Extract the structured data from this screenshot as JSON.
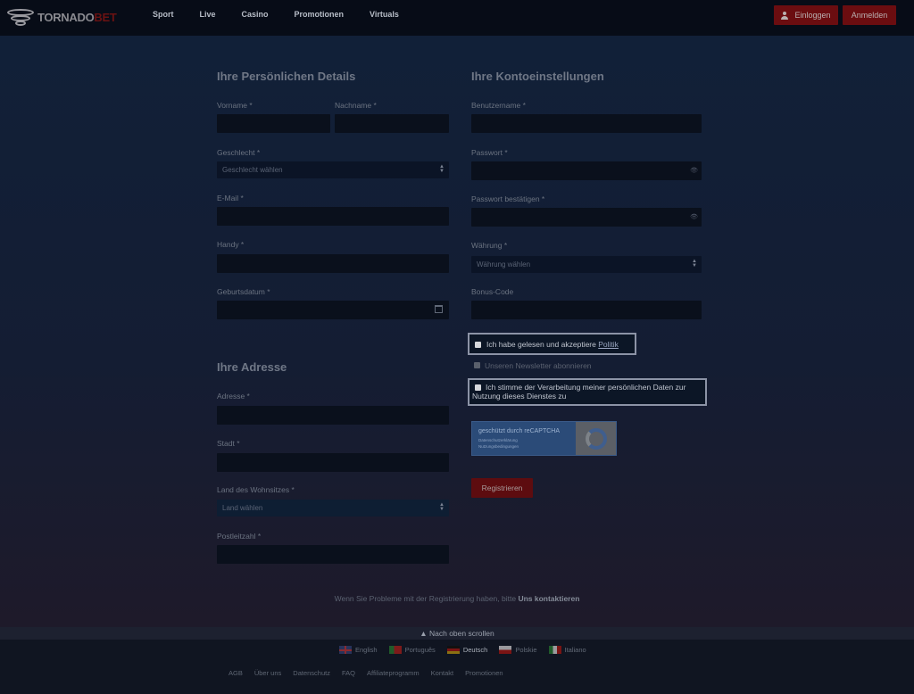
{
  "header": {
    "logo_text_a": "TORNADO",
    "logo_text_b": "BET",
    "nav": [
      "Sport",
      "Live",
      "Casino",
      "Promotionen",
      "Virtuals"
    ],
    "login_label": "Einloggen",
    "register_label": "Anmelden"
  },
  "personal": {
    "title": "Ihre Persönlichen Details",
    "firstname_label": "Vorname *",
    "lastname_label": "Nachname *",
    "gender_label": "Geschlecht *",
    "gender_value": "Geschlecht wählen",
    "email_label": "E-Mail *",
    "mobile_label": "Handy *",
    "birthdate_label": "Geburtsdatum *"
  },
  "address": {
    "title": "Ihre Adresse",
    "address_label": "Adresse *",
    "city_label": "Stadt *",
    "country_label": "Land des Wohnsitzes *",
    "country_value": "Land wählen",
    "zip_label": "Postleitzahl *"
  },
  "account": {
    "title": "Ihre Kontoeinstellungen",
    "username_label": "Benutzername *",
    "password_label": "Passwort *",
    "password_confirm_label": "Passwort bestätigen *",
    "currency_label": "Währung *",
    "currency_value": "Währung wählen",
    "bonus_label": "Bonus-Code",
    "eye_glyph": "👁"
  },
  "consents": {
    "policy_text": "Ich habe gelesen und akzeptiere ",
    "policy_link": "Politik",
    "newsletter_text": "Unseren Newsletter abonnieren",
    "data_text": "Ich stimme der Verarbeitung meiner persönlichen Daten zur Nutzung dieses Dienstes zu"
  },
  "recaptcha": {
    "title": "geschützt durch reCAPTCHA",
    "line1": "Datenschutzerklärung",
    "line2": "Nutzungsbedingungen"
  },
  "submit_label": "Registrieren",
  "help": {
    "text": "Wenn Sie Probleme mit der Registrierung haben, bitte ",
    "link": "Uns kontaktieren"
  },
  "scroll_top": "▲ Nach oben scrollen",
  "footer": {
    "languages": [
      "English",
      "Português",
      "Deutsch",
      "Polskie",
      "Italiano"
    ],
    "active_language": "Deutsch",
    "links": [
      "AGB",
      "Über uns",
      "Datenschutz",
      "FAQ",
      "Affiliateprogramm",
      "Kontakt",
      "Promotionen"
    ]
  }
}
